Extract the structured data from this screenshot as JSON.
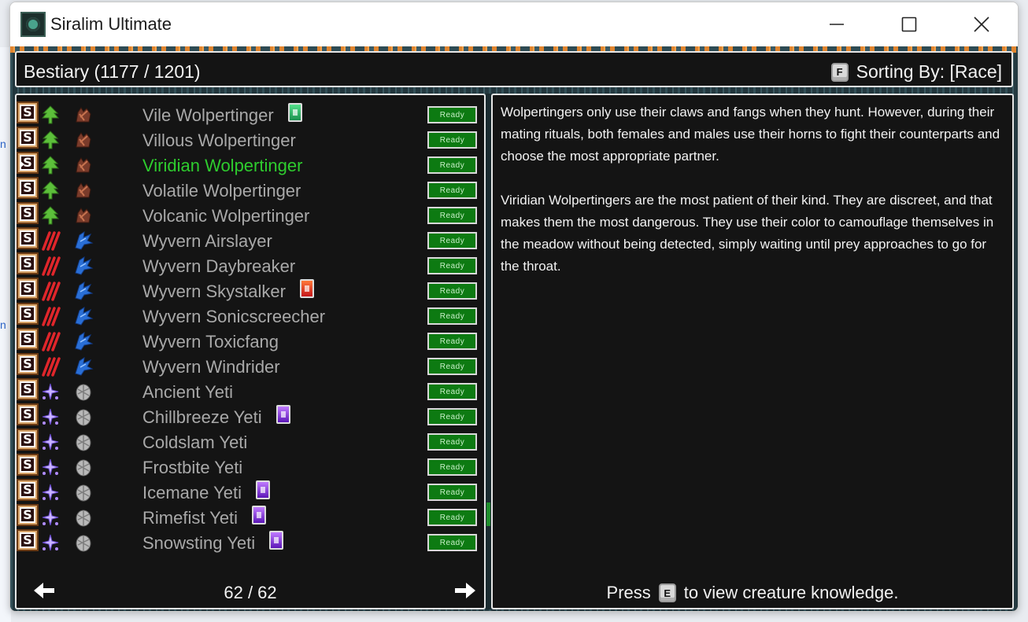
{
  "window": {
    "title": "Siralim Ultimate"
  },
  "header": {
    "title": "Bestiary (1177 / 1201)",
    "sort_key": "F",
    "sort_label": "Sorting By: [Race]"
  },
  "colors": {
    "selected": "#2ecc2e",
    "ready_bg": "#0d7a12",
    "name_default": "#a9a9a9"
  },
  "creatures": [
    {
      "name": "Vile Wolpertinger",
      "class_icon": "nature-tree-icon",
      "race_icon": "wolpertinger-icon",
      "card": "green",
      "status": "Ready",
      "selected": false
    },
    {
      "name": "Villous Wolpertinger",
      "class_icon": "nature-tree-icon",
      "race_icon": "wolpertinger-icon",
      "card": "",
      "status": "Ready",
      "selected": false
    },
    {
      "name": "Viridian Wolpertinger",
      "class_icon": "nature-tree-icon",
      "race_icon": "wolpertinger-icon",
      "card": "",
      "status": "Ready",
      "selected": true
    },
    {
      "name": "Volatile Wolpertinger",
      "class_icon": "nature-tree-icon",
      "race_icon": "wolpertinger-icon",
      "card": "",
      "status": "Ready",
      "selected": false
    },
    {
      "name": "Volcanic Wolpertinger",
      "class_icon": "nature-tree-icon",
      "race_icon": "wolpertinger-icon",
      "card": "",
      "status": "Ready",
      "selected": false
    },
    {
      "name": "Wyvern Airslayer",
      "class_icon": "chaos-claw-icon",
      "race_icon": "wyvern-icon",
      "card": "",
      "status": "Ready",
      "selected": false
    },
    {
      "name": "Wyvern Daybreaker",
      "class_icon": "chaos-claw-icon",
      "race_icon": "wyvern-icon",
      "card": "",
      "status": "Ready",
      "selected": false
    },
    {
      "name": "Wyvern Skystalker",
      "class_icon": "chaos-claw-icon",
      "race_icon": "wyvern-icon",
      "card": "red",
      "status": "Ready",
      "selected": false
    },
    {
      "name": "Wyvern Sonicscreecher",
      "class_icon": "chaos-claw-icon",
      "race_icon": "wyvern-icon",
      "card": "",
      "status": "Ready",
      "selected": false
    },
    {
      "name": "Wyvern Toxicfang",
      "class_icon": "chaos-claw-icon",
      "race_icon": "wyvern-icon",
      "card": "",
      "status": "Ready",
      "selected": false
    },
    {
      "name": "Wyvern Windrider",
      "class_icon": "chaos-claw-icon",
      "race_icon": "wyvern-icon",
      "card": "",
      "status": "Ready",
      "selected": false
    },
    {
      "name": "Ancient Yeti",
      "class_icon": "sorcery-star-icon",
      "race_icon": "yeti-icon",
      "card": "",
      "status": "Ready",
      "selected": false
    },
    {
      "name": "Chillbreeze Yeti",
      "class_icon": "sorcery-star-icon",
      "race_icon": "yeti-icon",
      "card": "purple",
      "status": "Ready",
      "selected": false
    },
    {
      "name": "Coldslam Yeti",
      "class_icon": "sorcery-star-icon",
      "race_icon": "yeti-icon",
      "card": "",
      "status": "Ready",
      "selected": false
    },
    {
      "name": "Frostbite Yeti",
      "class_icon": "sorcery-star-icon",
      "race_icon": "yeti-icon",
      "card": "",
      "status": "Ready",
      "selected": false
    },
    {
      "name": "Icemane Yeti",
      "class_icon": "sorcery-star-icon",
      "race_icon": "yeti-icon",
      "card": "purple",
      "status": "Ready",
      "selected": false
    },
    {
      "name": "Rimefist Yeti",
      "class_icon": "sorcery-star-icon",
      "race_icon": "yeti-icon",
      "card": "purple",
      "status": "Ready",
      "selected": false
    },
    {
      "name": "Snowsting Yeti",
      "class_icon": "sorcery-star-icon",
      "race_icon": "yeti-icon",
      "card": "purple",
      "status": "Ready",
      "selected": false
    }
  ],
  "pager": {
    "count": "62 / 62",
    "prev_icon": "arrow-left-icon",
    "next_icon": "arrow-right-icon"
  },
  "description": {
    "paragraphs": [
      "Wolpertingers only use their claws and fangs when they hunt. However, during their mating rituals, both females and males use their horns to fight their counterparts and choose the most appropriate partner.",
      "Viridian Wolpertingers are the most patient of their kind. They are discreet, and that makes them the most dangerous. They use their color to camouflage themselves in the meadow without being detected, simply waiting until prey approaches to go for the throat."
    ],
    "knowledge_press": "Press",
    "knowledge_key": "E",
    "knowledge_rest": "to view creature knowledge."
  }
}
